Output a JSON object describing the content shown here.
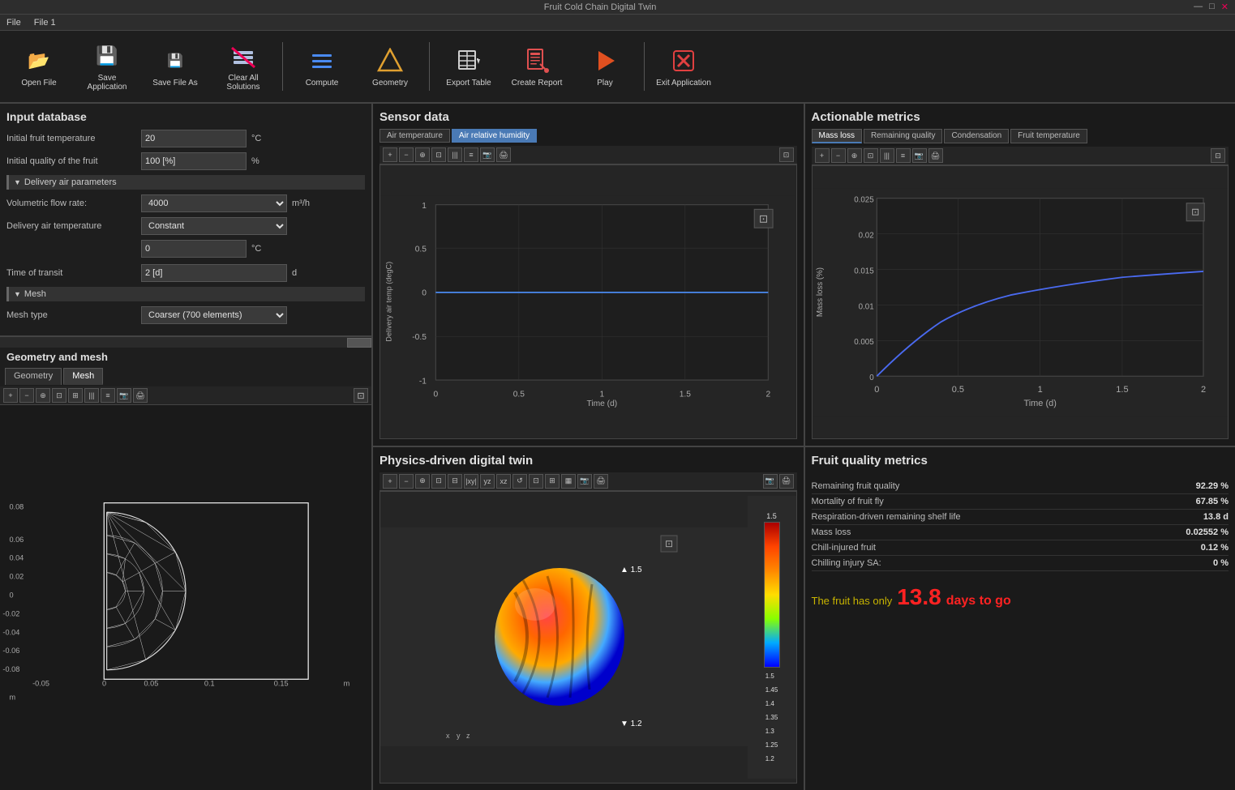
{
  "titlebar": {
    "text": "— □ ×"
  },
  "menubar": {
    "items": [
      "File",
      "File 1"
    ]
  },
  "toolbar": {
    "buttons": [
      {
        "id": "open-file",
        "label": "Open File",
        "icon": "📂"
      },
      {
        "id": "save-application",
        "label": "Save Application",
        "icon": "💾"
      },
      {
        "id": "save-file-as",
        "label": "Save File As",
        "icon": "💾"
      },
      {
        "id": "clear-solutions",
        "label": "Clear All Solutions",
        "icon": "🧹"
      },
      {
        "id": "compute",
        "label": "Compute",
        "icon": "≡"
      },
      {
        "id": "geometry",
        "label": "Geometry",
        "icon": "△"
      },
      {
        "id": "export-table",
        "label": "Export Table",
        "icon": "⊟"
      },
      {
        "id": "create-report",
        "label": "Create Report",
        "icon": "📋"
      },
      {
        "id": "play",
        "label": "Play",
        "icon": "▶"
      },
      {
        "id": "exit-application",
        "label": "Exit Application",
        "icon": "✕"
      }
    ]
  },
  "input_db": {
    "title": "Input database",
    "fields": [
      {
        "label": "Initial fruit temperature",
        "value": "20",
        "unit": "°C"
      },
      {
        "label": "Initial quality of the fruit",
        "value": "100 [%]",
        "unit": "%"
      }
    ],
    "delivery_air": {
      "header": "Delivery air parameters",
      "fields": [
        {
          "label": "Volumetric flow rate:",
          "value": "4000",
          "unit": "m³/h",
          "type": "dropdown"
        },
        {
          "label": "Delivery air temperature",
          "value": "Constant",
          "type": "dropdown"
        },
        {
          "label": "",
          "value": "0",
          "unit": "°C"
        }
      ]
    },
    "transit": {
      "label": "Time of transit",
      "value": "2 [d]",
      "unit": "d"
    },
    "mesh": {
      "header": "Mesh",
      "type_label": "Mesh type",
      "type_value": "Coarser (700 elements)"
    }
  },
  "geometry_mesh": {
    "title": "Geometry and mesh",
    "tabs": [
      "Geometry",
      "Mesh"
    ],
    "active_tab": "Mesh",
    "axis_labels": {
      "x_min": "-0.05",
      "x_mid": "0",
      "x_max": "0.05",
      "x_max2": "0.1",
      "x_max3": "0.15",
      "y_min": "-0.08",
      "y_mid": "0",
      "y_max": "0.08",
      "y_label1": "0.06",
      "y_label2": "0.04",
      "y_label3": "0.02",
      "y_label4": "-0.02",
      "y_label5": "-0.04",
      "y_label6": "-0.06"
    },
    "unit": "m"
  },
  "sensor_data": {
    "title": "Sensor data",
    "tabs": [
      "Air temperature",
      "Air relative humidity"
    ],
    "active_tab": "Air relative humidity",
    "chart": {
      "x_label": "Time (d)",
      "y_label": "Delivery air temp (degC)",
      "x_ticks": [
        "0",
        "0.5",
        "1",
        "1.5",
        "2"
      ],
      "y_ticks": [
        "-1",
        "-0.5",
        "0",
        "0.5",
        "1"
      ]
    }
  },
  "actionable_metrics": {
    "title": "Actionable metrics",
    "tabs": [
      "Mass loss",
      "Remaining quality",
      "Condensation",
      "Fruit temperature"
    ],
    "active_tab": "Mass loss",
    "chart": {
      "x_label": "Time (d)",
      "y_label": "Mass loss (%)",
      "x_ticks": [
        "0",
        "0.5",
        "1",
        "1.5",
        "2"
      ],
      "y_ticks": [
        "0",
        "0.005",
        "0.01",
        "0.015",
        "0.02",
        "0.025"
      ]
    }
  },
  "digital_twin": {
    "title": "Physics-driven digital twin",
    "colorbar": {
      "max": "1.5",
      "values": [
        "1.5",
        "1.45",
        "1.4",
        "1.35",
        "1.3",
        "1.25"
      ],
      "min": "1.2"
    }
  },
  "fruit_quality": {
    "title": "Fruit quality metrics",
    "metrics": [
      {
        "label": "Remaining fruit quality",
        "value": "92.29 %"
      },
      {
        "label": "Mortality of fruit fly",
        "value": "67.85 %"
      },
      {
        "label": "Respiration-driven remaining shelf life",
        "value": "13.8 d"
      },
      {
        "label": "Mass loss",
        "value": "0.02552 %"
      },
      {
        "label": "Chill-injured fruit",
        "value": "0.12 %"
      },
      {
        "label": "Chilling injury SA:",
        "value": "0 %"
      }
    ],
    "message": {
      "prefix": "The fruit has only",
      "number": "13.8",
      "suffix": "days to go"
    }
  }
}
